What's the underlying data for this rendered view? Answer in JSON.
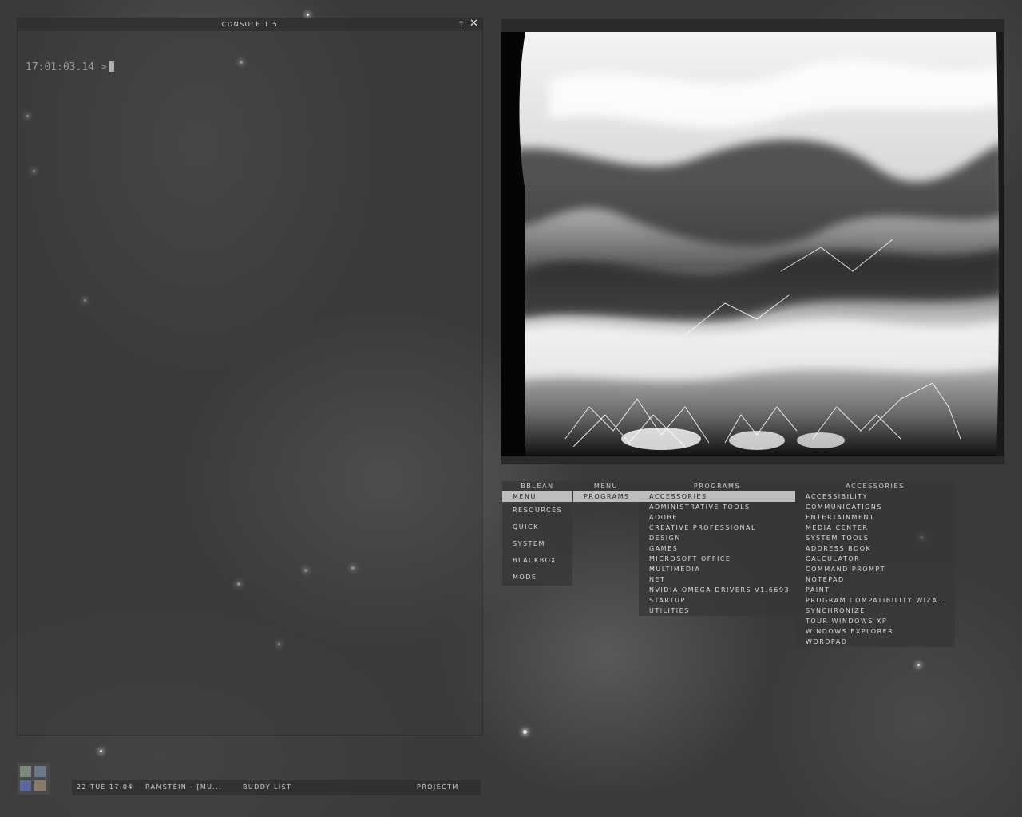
{
  "console": {
    "title": "CONSOLE 1.5",
    "prompt": "17:01:03.14 >"
  },
  "icons": {
    "console_up": "arrow-up-icon",
    "console_close": "close-icon",
    "tray": "tray-icon"
  },
  "menus": {
    "bblean": {
      "title": "BBLEAN",
      "items": [
        "MENU",
        "RESOURCES",
        "QUICK",
        "SYSTEM",
        "BLACKBOX",
        "MODE"
      ],
      "selected_index": 0
    },
    "menu": {
      "title": "MENU",
      "items": [
        "PROGRAMS"
      ],
      "selected_index": 0
    },
    "programs": {
      "title": "PROGRAMS",
      "items": [
        "ACCESSORIES",
        "ADMINISTRATIVE TOOLS",
        "ADOBE",
        "CREATIVE PROFESSIONAL",
        "DESIGN",
        "GAMES",
        "MICROSOFT OFFICE",
        "MULTIMEDIA",
        "NET",
        "NVIDIA OMEGA DRIVERS V1.6693",
        "STARTUP",
        "UTILITIES"
      ],
      "selected_index": 0
    },
    "accessories": {
      "title": "ACCESSORIES",
      "items": [
        "ACCESSIBILITY",
        "COMMUNICATIONS",
        "ENTERTAINMENT",
        "MEDIA CENTER",
        "SYSTEM TOOLS",
        "ADDRESS BOOK",
        "CALCULATOR",
        "COMMAND PROMPT",
        "NOTEPAD",
        "PAINT",
        "PROGRAM COMPATIBILITY WIZA...",
        "SYNCHRONIZE",
        "TOUR WINDOWS XP",
        "WINDOWS EXPLORER",
        "WORDPAD"
      ]
    }
  },
  "taskbar": {
    "clock": "22 TUE 17:04",
    "tasks": [
      "RAMSTEIN - [MU...",
      "BUDDY LIST"
    ],
    "right_label": "PROJECTM"
  },
  "colors": {
    "panel": "#3c3c3c",
    "selected_item": "#bdbdbd",
    "text": "#dcdcdc"
  }
}
